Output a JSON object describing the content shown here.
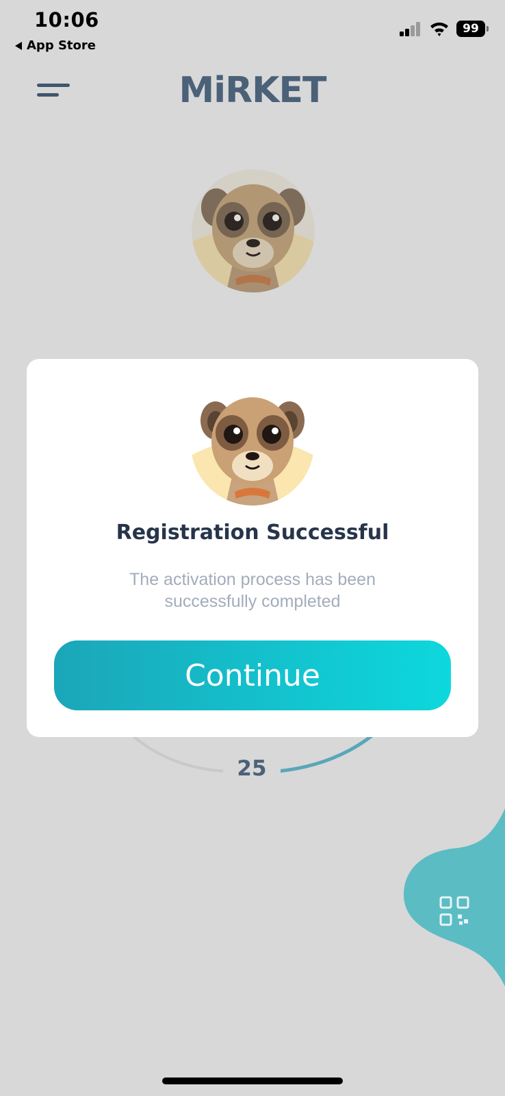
{
  "status_bar": {
    "time": "10:06",
    "back_app": "App Store",
    "battery": "99",
    "icons": [
      "cellular-signal-icon",
      "wifi-icon",
      "battery-icon"
    ]
  },
  "header": {
    "brand": "MiRKET",
    "menu_icon": "hamburger-menu-icon"
  },
  "gauge": {
    "value": "25",
    "progress_color": "#5aa6b8"
  },
  "modal": {
    "title": "Registration Successful",
    "message": "The activation process has been successfully completed",
    "continue_label": "Continue"
  },
  "fab": {
    "icon": "qr-code-icon",
    "color": "#5bbcc4"
  },
  "colors": {
    "background": "#d8d8d8",
    "brand": "#4a6178",
    "title": "#27344a",
    "message": "#a3acbb",
    "button_gradient_start": "#1ba6b9",
    "button_gradient_end": "#0dd8dd"
  }
}
